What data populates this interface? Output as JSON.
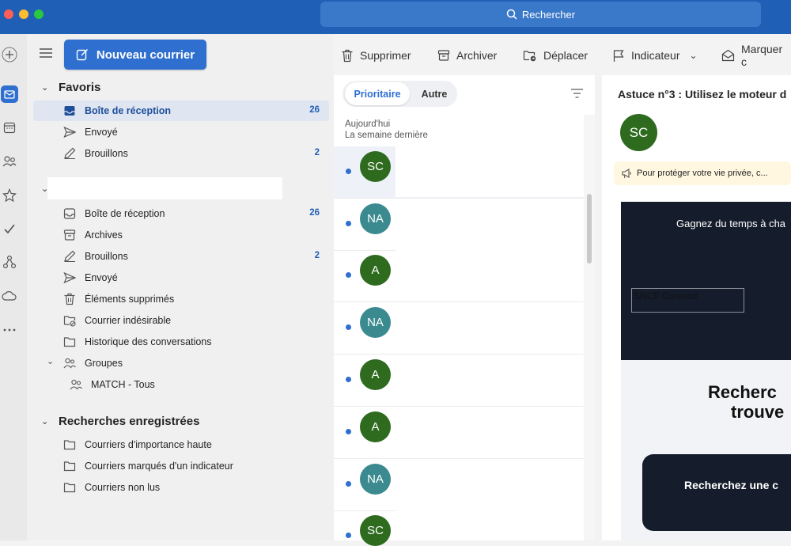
{
  "search": {
    "label": "Rechercher"
  },
  "new_mail": {
    "label": "Nouveau courrier"
  },
  "toolbar": {
    "delete": "Supprimer",
    "archive": "Archiver",
    "move": "Déplacer",
    "flag": "Indicateur",
    "mark": "Marquer c"
  },
  "favorites": {
    "header": "Favoris",
    "items": [
      {
        "label": "Boîte de réception",
        "count": "26",
        "icon": "inbox-icon"
      },
      {
        "label": "Envoyé",
        "count": "",
        "icon": "send-icon"
      },
      {
        "label": "Brouillons",
        "count": "2",
        "icon": "draft-icon"
      }
    ]
  },
  "account": {
    "items": [
      {
        "label": "Boîte de réception",
        "count": "26",
        "icon": "inbox-icon"
      },
      {
        "label": "Archives",
        "count": "",
        "icon": "archive-icon"
      },
      {
        "label": "Brouillons",
        "count": "2",
        "icon": "draft-icon"
      },
      {
        "label": "Envoyé",
        "count": "",
        "icon": "send-icon"
      },
      {
        "label": "Éléments supprimés",
        "count": "",
        "icon": "trash-icon"
      },
      {
        "label": "Courrier indésirable",
        "count": "",
        "icon": "junk-icon"
      },
      {
        "label": "Historique des conversations",
        "count": "",
        "icon": "folder-icon"
      },
      {
        "label": "Groupes",
        "count": "",
        "icon": "groups-icon"
      },
      {
        "label": "MATCH - Tous",
        "count": "",
        "icon": "groups-icon"
      }
    ]
  },
  "saved_searches": {
    "header": "Recherches enregistrées",
    "items": [
      {
        "label": "Courriers d'importance haute"
      },
      {
        "label": "Courriers marqués d'un indicateur"
      },
      {
        "label": "Courriers non lus"
      }
    ]
  },
  "list": {
    "tab_focused": "Prioritaire",
    "tab_other": "Autre",
    "group_today": "Aujourd'hui",
    "group_last_week": "La semaine dernière",
    "messages": [
      {
        "initials": "SC",
        "color": "#2e6b1f"
      },
      {
        "initials": "NA",
        "color": "#3a8a8f"
      },
      {
        "initials": "A",
        "color": "#2e6b1f"
      },
      {
        "initials": "NA",
        "color": "#3a8a8f"
      },
      {
        "initials": "A",
        "color": "#2e6b1f"
      },
      {
        "initials": "A",
        "color": "#2e6b1f"
      },
      {
        "initials": "NA",
        "color": "#3a8a8f"
      },
      {
        "initials": "SC",
        "color": "#2e6b1f"
      }
    ]
  },
  "reading": {
    "subject": "Astuce n°3 : Utilisez le moteur d",
    "sender_initials": "SC",
    "privacy_notice": "Pour protéger votre vie privée, c...",
    "banner_text": "Gagnez du temps à cha",
    "image_alt": "SNCF Connect",
    "headline_line1": "Recherc",
    "headline_line2": "trouve",
    "cta": "Recherchez une c"
  }
}
